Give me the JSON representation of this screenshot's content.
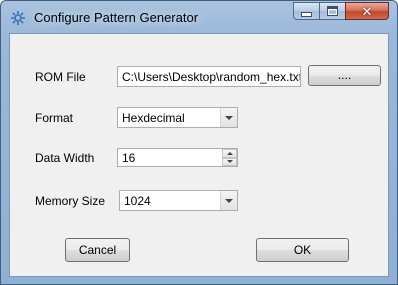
{
  "window": {
    "title": "Configure Pattern Generator",
    "caption_buttons": {
      "minimize": "minimize",
      "maximize": "maximize",
      "close": "✕"
    }
  },
  "form": {
    "rom_file": {
      "label": "ROM File",
      "value": "C:\\Users\\Desktop\\random_hex.txt",
      "browse_label": "...."
    },
    "format": {
      "label": "Format",
      "value": "Hexdecimal"
    },
    "data_width": {
      "label": "Data Width",
      "value": "16"
    },
    "memory_size": {
      "label": "Memory Size",
      "value": "1024"
    }
  },
  "actions": {
    "cancel_label": "Cancel",
    "ok_label": "OK"
  }
}
